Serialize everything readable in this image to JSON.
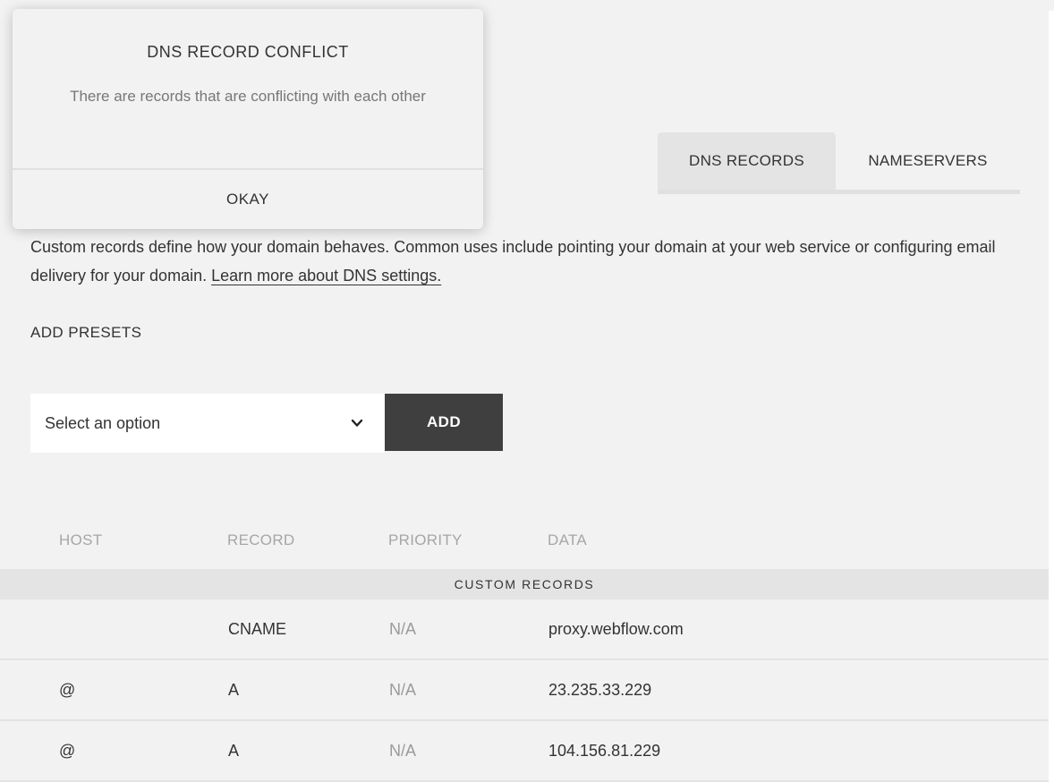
{
  "modal": {
    "title": "DNS RECORD CONFLICT",
    "message": "There are records that are conflicting with each other",
    "okay_label": "OKAY"
  },
  "tabs": [
    {
      "label": "DNS RECORDS",
      "active": true
    },
    {
      "label": "NAMESERVERS",
      "active": false
    }
  ],
  "description": {
    "text": "Custom records define how your domain behaves. Common uses include pointing your domain at your web service or configuring email delivery for your domain. ",
    "link": "Learn more about DNS settings."
  },
  "presets": {
    "heading": "ADD PRESETS",
    "select_value": "Select an option",
    "add_label": "ADD"
  },
  "table": {
    "headers": {
      "host": "HOST",
      "record": "RECORD",
      "priority": "PRIORITY",
      "data": "DATA"
    },
    "section_label": "CUSTOM RECORDS",
    "rows": [
      {
        "host": "",
        "record": "CNAME",
        "priority": "N/A",
        "data": "proxy.webflow.com"
      },
      {
        "host": "@",
        "record": "A",
        "priority": "N/A",
        "data": "23.235.33.229"
      },
      {
        "host": "@",
        "record": "A",
        "priority": "N/A",
        "data": "104.156.81.229"
      }
    ]
  },
  "icons": {
    "select_chevron": "chevron-down-icon"
  },
  "colors": {
    "background": "#f2f2f2",
    "add_button": "#3f3f3f",
    "band": "#e4e4e4",
    "muted_text": "#9a9a9a",
    "header_text": "#a6a6a6"
  }
}
